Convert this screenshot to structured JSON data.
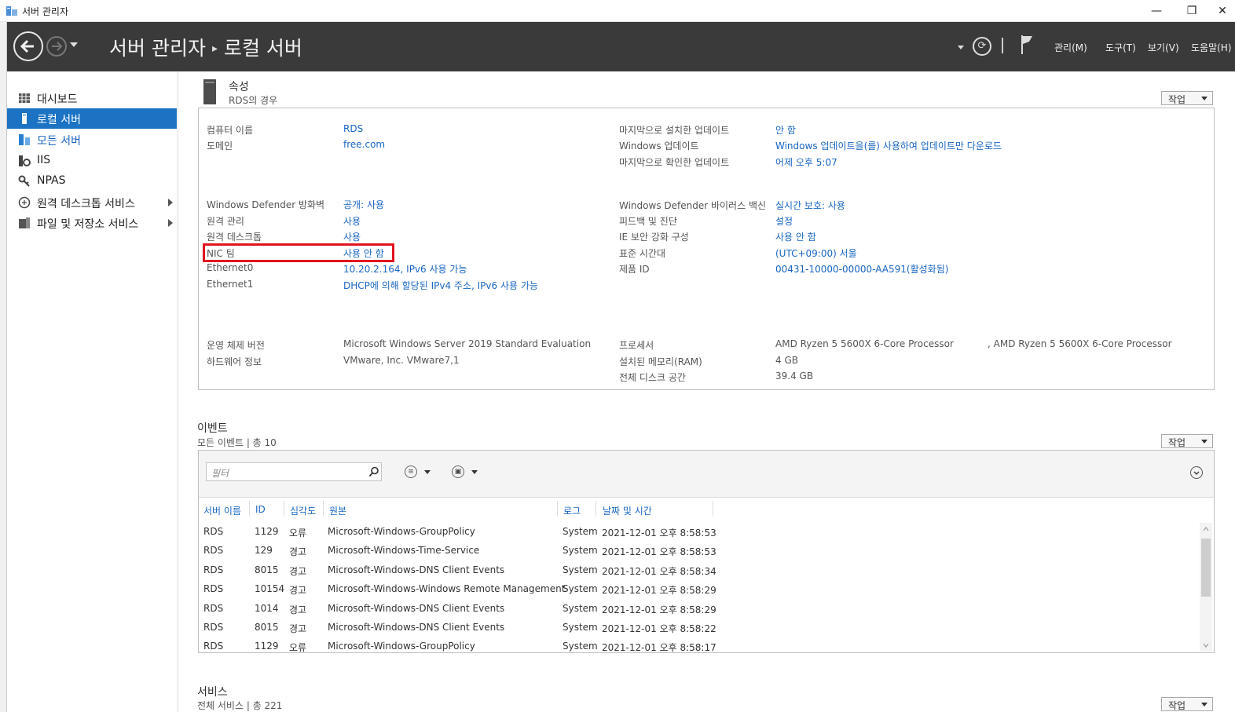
{
  "window": {
    "title": "서버 관리자",
    "min_icon": "minimize-icon",
    "restore_icon": "restore-icon",
    "close_icon": "close-icon"
  },
  "header": {
    "breadcrumb_root": "서버 관리자",
    "breadcrumb_sep": "▸",
    "breadcrumb_current": "로컬 서버",
    "menus": [
      "관리(M)",
      "도구(T)",
      "보기(V)",
      "도움말(H)"
    ]
  },
  "sidebar": {
    "items": [
      {
        "label": "대시보드"
      },
      {
        "label": "로컬 서버",
        "active": true
      },
      {
        "label": "모든 서버"
      },
      {
        "label": "IIS"
      },
      {
        "label": "NPAS"
      },
      {
        "label": "원격 데스크톱 서비스",
        "expandable": true
      },
      {
        "label": "파일 및 저장소 서비스",
        "expandable": true
      }
    ]
  },
  "properties": {
    "title": "속성",
    "subtitle": "RDS의 경우",
    "task_label": "작업",
    "left": [
      {
        "label": "컴퓨터 이름",
        "value": "RDS"
      },
      {
        "label": "도메인",
        "value": "free.com"
      },
      {
        "label": "Windows Defender 방화벽",
        "value": "공개: 사용"
      },
      {
        "label": "원격 관리",
        "value": "사용"
      },
      {
        "label": "원격 데스크톱",
        "value": "사용"
      },
      {
        "label": "NIC 팀",
        "value": "사용 안 함"
      },
      {
        "label": "Ethernet0",
        "value": "10.20.2.164, IPv6 사용 가능"
      },
      {
        "label": "Ethernet1",
        "value": "DHCP에 의해 할당된 IPv4 주소, IPv6 사용 가능"
      },
      {
        "label": "운영 체제 버전",
        "value": "Microsoft Windows Server 2019 Standard Evaluation"
      },
      {
        "label": "하드웨어 정보",
        "value": "VMware, Inc. VMware7,1"
      }
    ],
    "right": [
      {
        "label": "마지막으로 설치한 업데이트",
        "value": "안 함"
      },
      {
        "label": "Windows 업데이트",
        "value": "Windows 업데이트을(를) 사용하여 업데이트만 다운로드"
      },
      {
        "label": "마지막으로 확인한 업데이트",
        "value": "어제 오후 5:07"
      },
      {
        "label": "Windows Defender 바이러스 백신",
        "value": "실시간 보호: 사용"
      },
      {
        "label": "피드백 및 진단",
        "value": "설정"
      },
      {
        "label": "IE 보안 강화 구성",
        "value": "사용 안 함"
      },
      {
        "label": "표준 시간대",
        "value": "(UTC+09:00) 서울"
      },
      {
        "label": "제품 ID",
        "value": "00431-10000-00000-AA591(활성화됨)"
      },
      {
        "label": "프로세서",
        "value": "AMD Ryzen 5 5600X 6-Core Processor",
        "value2": ", AMD Ryzen 5 5600X 6-Core Processor"
      },
      {
        "label": "설치된 메모리(RAM)",
        "value": "4 GB"
      },
      {
        "label": "전체 디스크 공간",
        "value": "39.4 GB"
      }
    ]
  },
  "events": {
    "title": "이벤트",
    "subtitle": "모든 이벤트 | 총 10",
    "task_label": "작업",
    "filter_placeholder": "필터",
    "columns": [
      "서버 이름",
      "ID",
      "심각도",
      "원본",
      "로그",
      "날짜 및 시간"
    ],
    "rows": [
      [
        "RDS",
        "1129",
        "오류",
        "Microsoft-Windows-GroupPolicy",
        "System",
        "2021-12-01 오후 8:58:53"
      ],
      [
        "RDS",
        "129",
        "경고",
        "Microsoft-Windows-Time-Service",
        "System",
        "2021-12-01 오후 8:58:53"
      ],
      [
        "RDS",
        "8015",
        "경고",
        "Microsoft-Windows-DNS Client Events",
        "System",
        "2021-12-01 오후 8:58:34"
      ],
      [
        "RDS",
        "10154",
        "경고",
        "Microsoft-Windows-Windows Remote Management",
        "System",
        "2021-12-01 오후 8:58:29"
      ],
      [
        "RDS",
        "1014",
        "경고",
        "Microsoft-Windows-DNS Client Events",
        "System",
        "2021-12-01 오후 8:58:29"
      ],
      [
        "RDS",
        "8015",
        "경고",
        "Microsoft-Windows-DNS Client Events",
        "System",
        "2021-12-01 오후 8:58:22"
      ],
      [
        "RDS",
        "1129",
        "오류",
        "Microsoft-Windows-GroupPolicy",
        "System",
        "2021-12-01 오후 8:58:17"
      ]
    ]
  },
  "services": {
    "title": "서비스",
    "subtitle": "전체 서비스 | 총 221",
    "task_label": "작업"
  },
  "colors": {
    "header_bg": "#3a3a3a",
    "active_nav": "#1c73c4",
    "link": "#1a66c2",
    "highlight_box": "#e0141e"
  }
}
